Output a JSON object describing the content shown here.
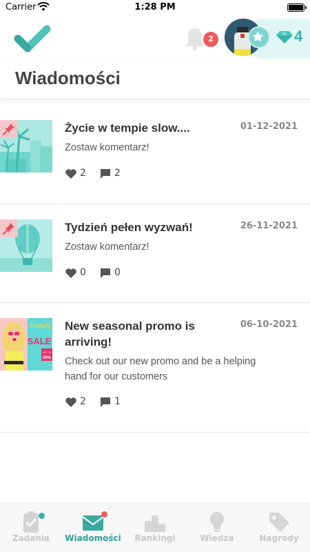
{
  "status_bar": {
    "carrier": "Carrier",
    "time": "1:28 PM"
  },
  "header": {
    "notification_count": "2",
    "gem_count": "4",
    "title": "Wiadomości"
  },
  "messages": [
    {
      "title": "Życie w tempie slow....",
      "date": "01-12-2021",
      "preview": "Zostaw komentarz!",
      "likes": "2",
      "comments": "2",
      "pinned": true,
      "thumbnail": "palm-trees-illustration"
    },
    {
      "title": "Tydzień pełen wyzwań!",
      "date": "26-11-2021",
      "preview": "Zostaw komentarz!",
      "likes": "0",
      "comments": "0",
      "pinned": true,
      "thumbnail": "hot-air-balloon-illustration"
    },
    {
      "title_line1": "New seasonal promo is",
      "title_line2": "arriving!",
      "date": "06-10-2021",
      "preview_line1": "Check out our new promo and be a helping",
      "preview_line2": "hand for our customers",
      "likes": "2",
      "comments": "1",
      "pinned": false,
      "thumbnail": "trendy-sale-photo",
      "thumbnail_text": {
        "trendy": "Trendy",
        "sale": "SALE",
        "badge": "UP TO",
        "percent": "50%"
      }
    }
  ],
  "tabs": [
    {
      "label": "Zadania",
      "icon": "clipboard-check-icon",
      "active": false,
      "has_dot": true
    },
    {
      "label": "Wiadomości",
      "icon": "envelope-icon",
      "active": true,
      "has_dot": true
    },
    {
      "label": "Rankingi",
      "icon": "podium-icon",
      "active": false,
      "has_dot": false
    },
    {
      "label": "Wiedza",
      "icon": "lightbulb-icon",
      "active": false,
      "has_dot": false
    },
    {
      "label": "Nagrody",
      "icon": "tag-icon",
      "active": false,
      "has_dot": false
    }
  ],
  "colors": {
    "accent": "#2f9f98",
    "badge_red": "#ef5a5a",
    "inactive_tab": "#c8c8c8",
    "gem_teal": "#3bb3aa"
  }
}
